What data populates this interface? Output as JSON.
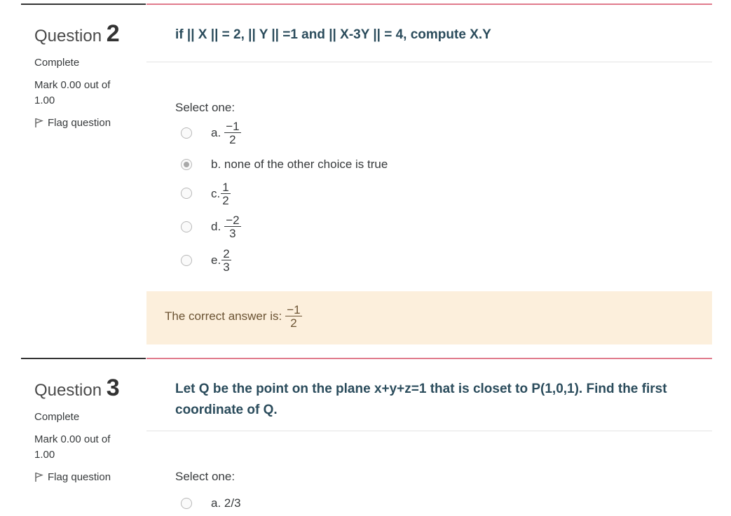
{
  "questions": [
    {
      "label": "Question",
      "number": "2",
      "state": "Complete",
      "grade": "Mark 0.00 out of 1.00",
      "flag": "Flag question",
      "text": "if || X || = 2, || Y || =1 and || X-3Y || = 4, compute X.Y",
      "prompt": "Select one:",
      "options": [
        {
          "letter": "a.",
          "num": "−1",
          "den": "2",
          "checked": false
        },
        {
          "letter": "b. none of the other choice is true",
          "checked": true
        },
        {
          "letter": "c.",
          "num": "1",
          "den": "2",
          "checked": false
        },
        {
          "letter": "d.",
          "num": "−2",
          "den": "3",
          "checked": false
        },
        {
          "letter": "e.",
          "num": "2",
          "den": "3",
          "checked": false
        }
      ],
      "feedback": {
        "label": "The correct answer is:",
        "num": "−1",
        "den": "2"
      }
    },
    {
      "label": "Question",
      "number": "3",
      "state": "Complete",
      "grade": "Mark 0.00 out of 1.00",
      "flag": "Flag question",
      "text": "Let Q be the point on the plane x+y+z=1 that is closet to P(1,0,1). Find the first coordinate of Q.",
      "prompt": "Select one:",
      "options": [
        {
          "letter": "a. 2/3",
          "checked": false
        }
      ]
    }
  ],
  "colors": {
    "accent_line": "#e07b8c",
    "question_text": "#2b4c5c",
    "feedback_bg": "#fcefdc"
  },
  "icons": {
    "flag": "flag-icon",
    "radio": "radio-button"
  }
}
